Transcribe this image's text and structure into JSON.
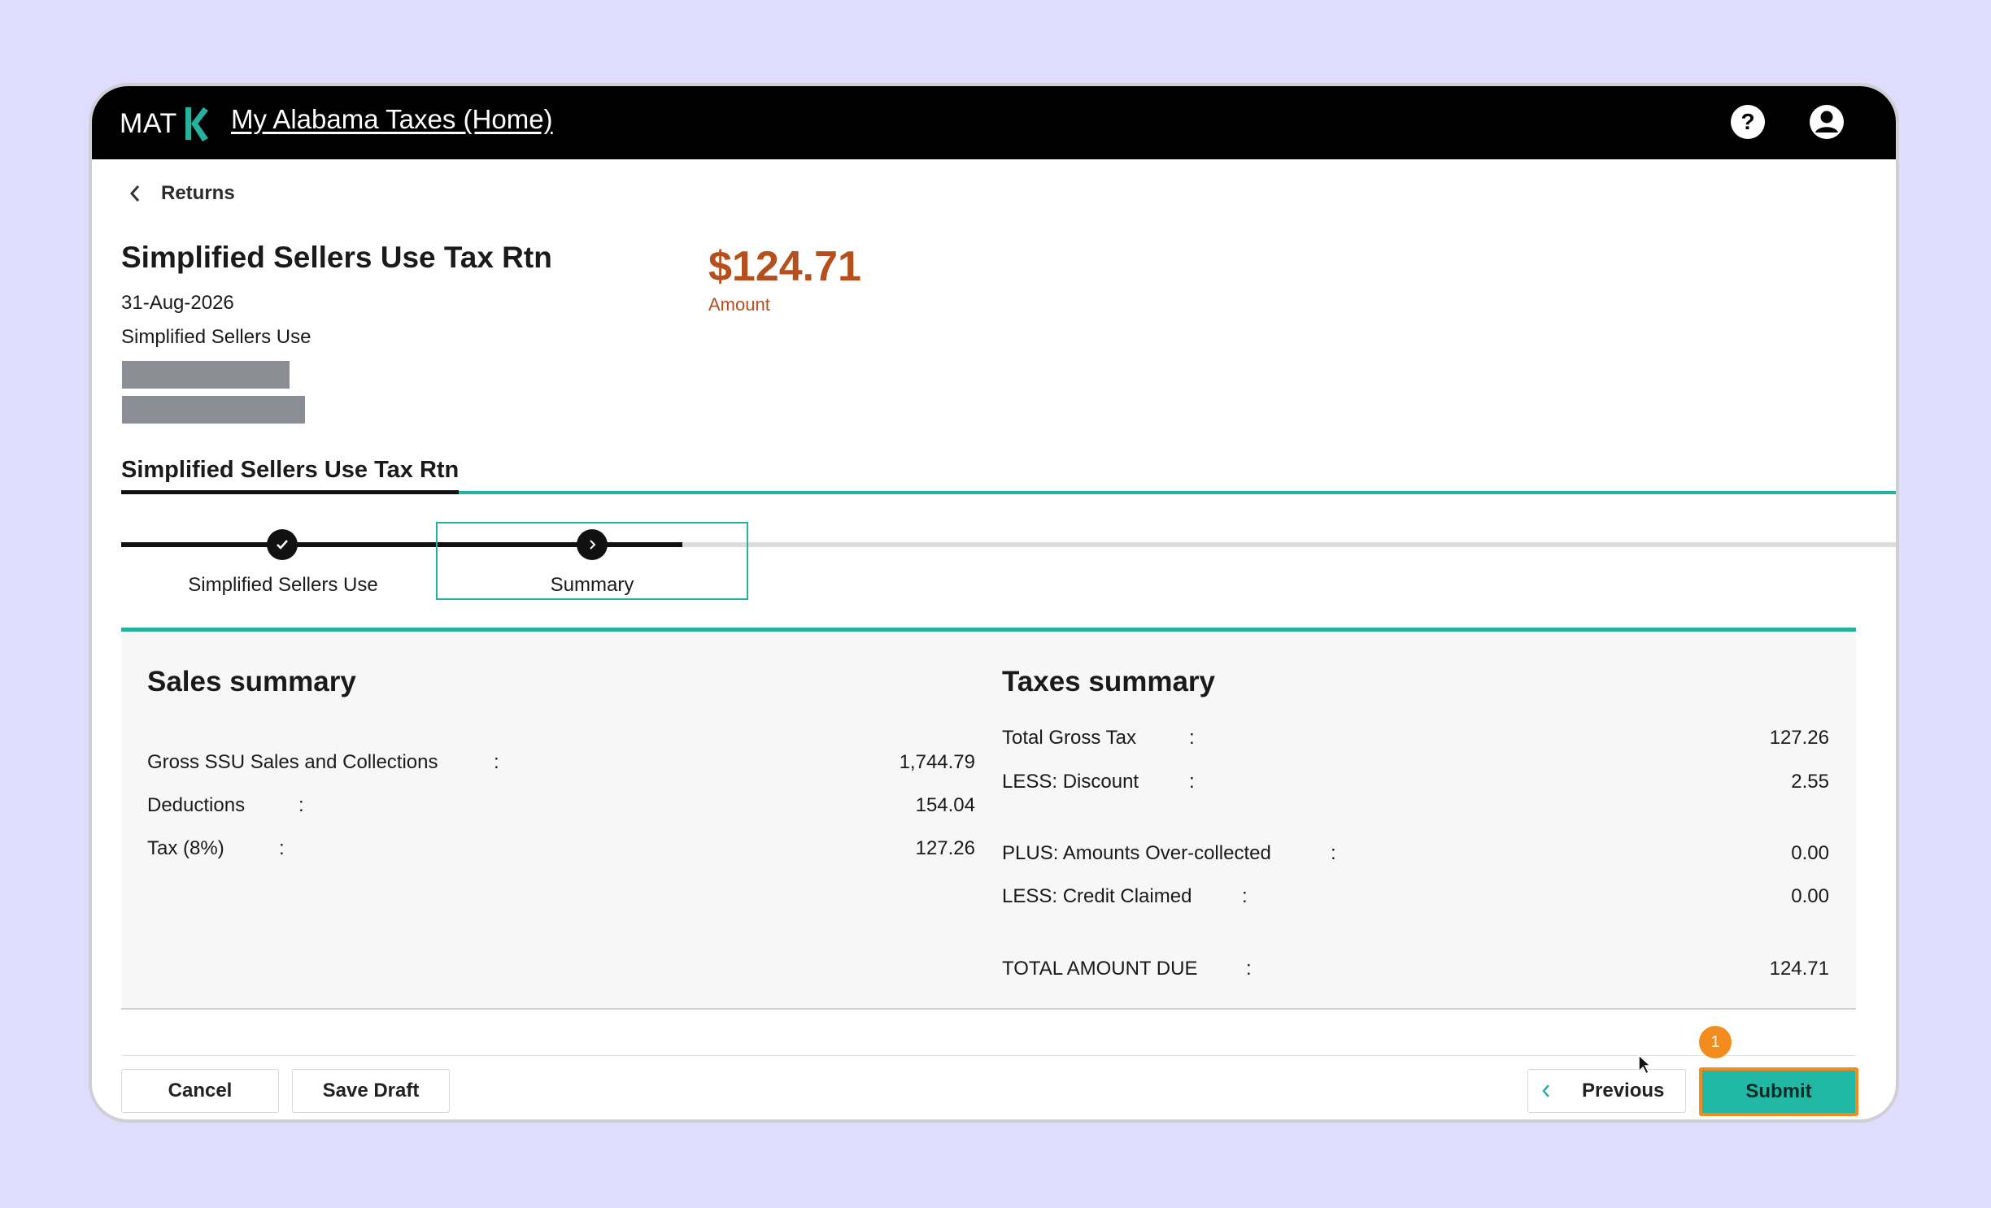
{
  "header": {
    "brand": "MAT",
    "home_link": "My Alabama Taxes (Home)",
    "help_icon": "help-circle-icon",
    "profile_icon": "account-circle-icon"
  },
  "nav": {
    "back_label": "Returns"
  },
  "return_info": {
    "title": "Simplified Sellers Use Tax Rtn",
    "period": "31-Aug-2026",
    "type": "Simplified Sellers Use",
    "amount": "$124.71",
    "amount_label": "Amount"
  },
  "section_tab": "Simplified Sellers Use Tax Rtn",
  "steps": [
    {
      "label": "Simplified Sellers Use",
      "status": "complete"
    },
    {
      "label": "Summary",
      "status": "current"
    }
  ],
  "sales_summary": {
    "heading": "Sales summary",
    "rows": [
      {
        "label": "Gross SSU Sales and Collections",
        "value": "1,744.79"
      },
      {
        "label": "Deductions",
        "value": "154.04"
      },
      {
        "label": "Tax (8%)",
        "value": "127.26"
      }
    ]
  },
  "taxes_summary": {
    "heading": "Taxes summary",
    "rows": [
      {
        "label": "Total Gross Tax",
        "value": "127.26"
      },
      {
        "label": "LESS: Discount",
        "value": "2.55"
      },
      {
        "label": "PLUS: Amounts Over-collected",
        "value": "0.00"
      },
      {
        "label": "LESS: Credit Claimed",
        "value": "0.00"
      },
      {
        "label": "TOTAL AMOUNT DUE",
        "value": "124.71"
      }
    ]
  },
  "colon": ":",
  "footer": {
    "cancel": "Cancel",
    "save_draft": "Save Draft",
    "previous": "Previous",
    "submit": "Submit",
    "badge": "1"
  },
  "colors": {
    "accent": "#25b3a0",
    "amount": "#b5501e",
    "highlight": "#f28c1e",
    "background": "#e0dcfd"
  }
}
